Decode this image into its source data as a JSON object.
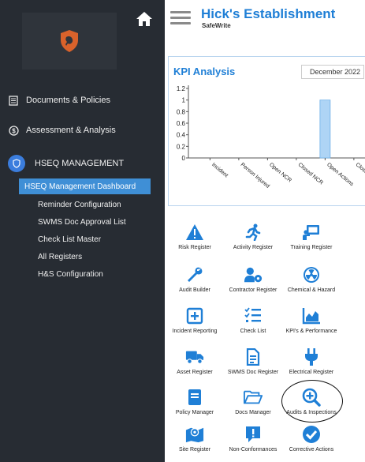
{
  "app": {
    "title": "Hick's Establishment",
    "subtitle": "SafeWrite"
  },
  "sidebar": {
    "items": [
      {
        "label": "Documents & Policies",
        "icon": "document-icon"
      },
      {
        "label": "Assessment & Analysis",
        "icon": "dollar-circle-icon"
      }
    ],
    "section": {
      "label": "HSEQ MANAGEMENT",
      "icon": "shield-icon"
    },
    "subitems": [
      {
        "label": "HSEQ Management Dashboard",
        "active": true
      },
      {
        "label": "Reminder Configuration"
      },
      {
        "label": "SWMS Doc Approval List"
      },
      {
        "label": "Check List Master"
      },
      {
        "label": "All Registers"
      },
      {
        "label": "H&S Configuration"
      }
    ]
  },
  "kpi": {
    "title": "KPI Analysis",
    "month": "December 2022"
  },
  "chart_data": {
    "type": "bar",
    "title": "",
    "categories": [
      "Incident",
      "Person Injured",
      "Open NCR",
      "Closed NCR",
      "Open Actions",
      "Closed Actions"
    ],
    "category_labels_visible": [
      "Incident",
      "Person Injured",
      "Open NCR",
      "Closed NCR",
      "Open Actions",
      "Closed Ac"
    ],
    "values": [
      0,
      0,
      0,
      0,
      1,
      0
    ],
    "yticks": [
      "1.2",
      "1",
      "0.8",
      "0.6",
      "0.4",
      "0.2",
      "0"
    ],
    "ylim": [
      0,
      1.2
    ],
    "bar_color": "#aed4f5"
  },
  "tiles": [
    {
      "label": "Risk Register",
      "icon": "warning-icon"
    },
    {
      "label": "Activity Register",
      "icon": "running-icon"
    },
    {
      "label": "Training Register",
      "icon": "presentation-icon"
    },
    {
      "label": "Audit Builder",
      "icon": "wrench-icon"
    },
    {
      "label": "Contractor Register",
      "icon": "user-gear-icon"
    },
    {
      "label": "Chemical & Hazard",
      "icon": "radiation-icon"
    },
    {
      "label": "Incident Reporting",
      "icon": "plus-square-icon"
    },
    {
      "label": "Check List",
      "icon": "checklist-icon"
    },
    {
      "label": "KPI's & Performance",
      "icon": "chart-area-icon"
    },
    {
      "label": "Asset Register",
      "icon": "truck-icon"
    },
    {
      "label": "SWMS Doc Register",
      "icon": "file-icon"
    },
    {
      "label": "Electrical Register",
      "icon": "plug-icon"
    },
    {
      "label": "Policy Manager",
      "icon": "book-icon"
    },
    {
      "label": "Docs Manager",
      "icon": "folder-open-icon"
    },
    {
      "label": "Audits & Inspections",
      "icon": "search-plus-icon"
    },
    {
      "label": "Site Register",
      "icon": "map-marker-icon"
    },
    {
      "label": "Non-Conformances",
      "icon": "alert-icon"
    },
    {
      "label": "Corrective Actions",
      "icon": "check-circle-icon"
    }
  ],
  "colors": {
    "accent": "#1f7fd6",
    "sidebar": "#272c33",
    "active": "#3f8fd6",
    "logo_orange": "#d9622b"
  }
}
